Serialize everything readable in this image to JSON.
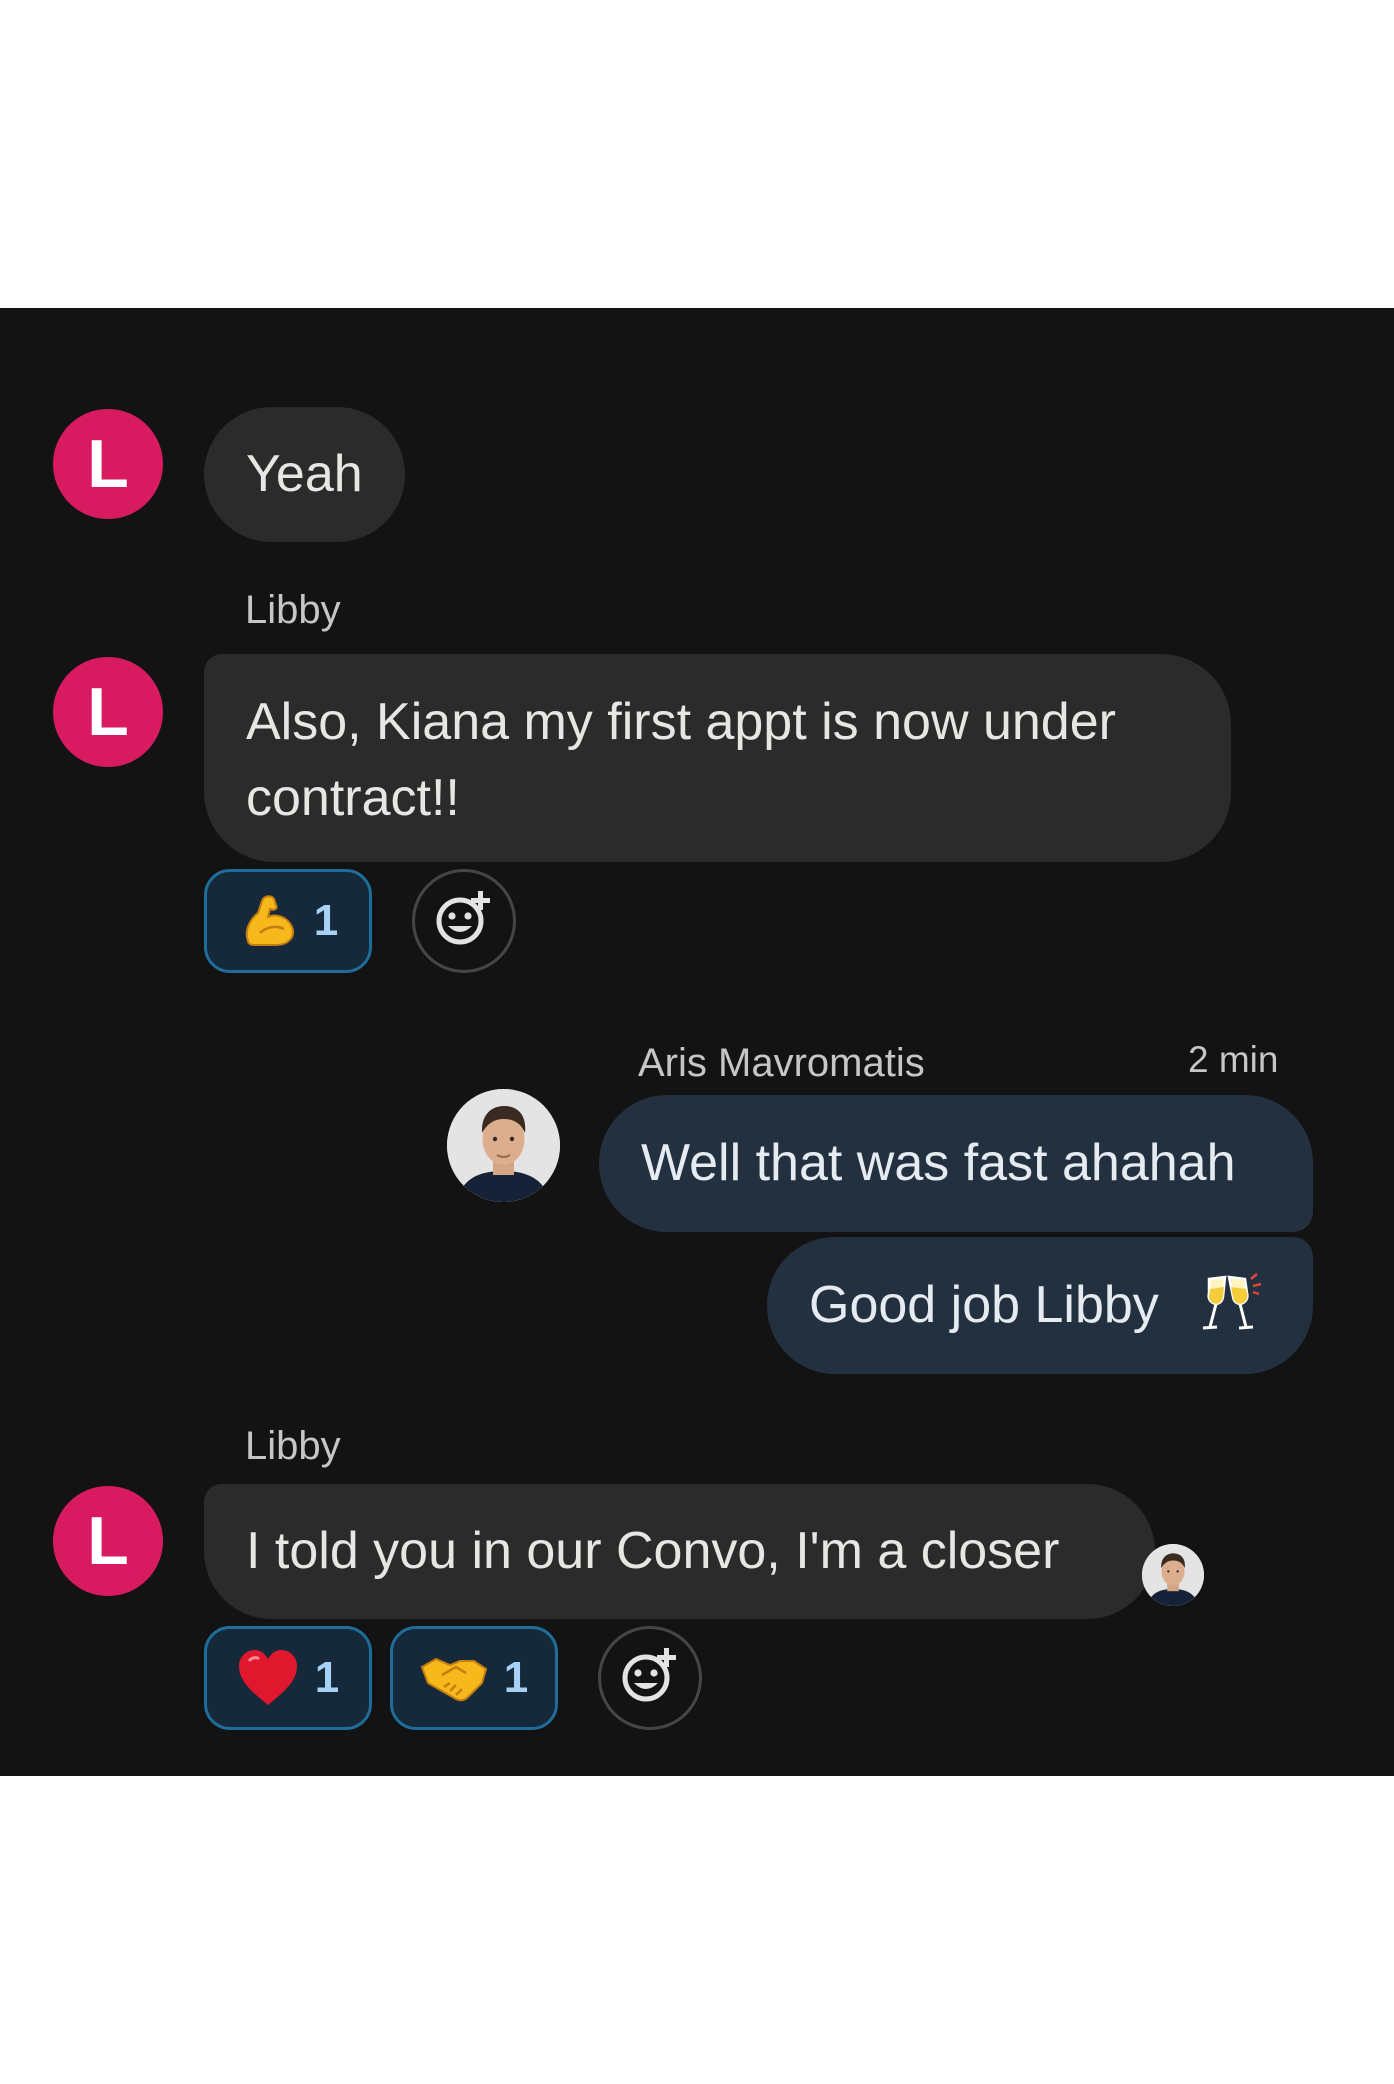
{
  "colors": {
    "panel_bg": "#131314",
    "bubble_incoming": "#2b2b2c",
    "bubble_outgoing": "#233040",
    "avatar_accent": "#d81b60",
    "reaction_border": "#1f6d9b",
    "reaction_bg": "#15293a"
  },
  "messages": [
    {
      "avatar_initial": "L",
      "text": "Yeah"
    },
    {
      "sender": "Libby",
      "avatar_initial": "L",
      "lines": [
        "Also, Kiana my first appt is now under",
        "contract!!"
      ],
      "reactions": [
        {
          "emoji": "flexed-biceps",
          "count": "1"
        }
      ]
    },
    {
      "sender": "Aris Mavromatis",
      "timestamp": "2 min",
      "texts": [
        "Well that was fast ahahah",
        "Good job Libby"
      ],
      "trailing_emoji": "clinking-glasses"
    },
    {
      "sender": "Libby",
      "avatar_initial": "L",
      "text": "I told you in our Convo, I'm a closer",
      "reactions": [
        {
          "emoji": "red-heart",
          "count": "1"
        },
        {
          "emoji": "handshake",
          "count": "1"
        }
      ],
      "read_receipt": "aris-avatar"
    }
  ]
}
